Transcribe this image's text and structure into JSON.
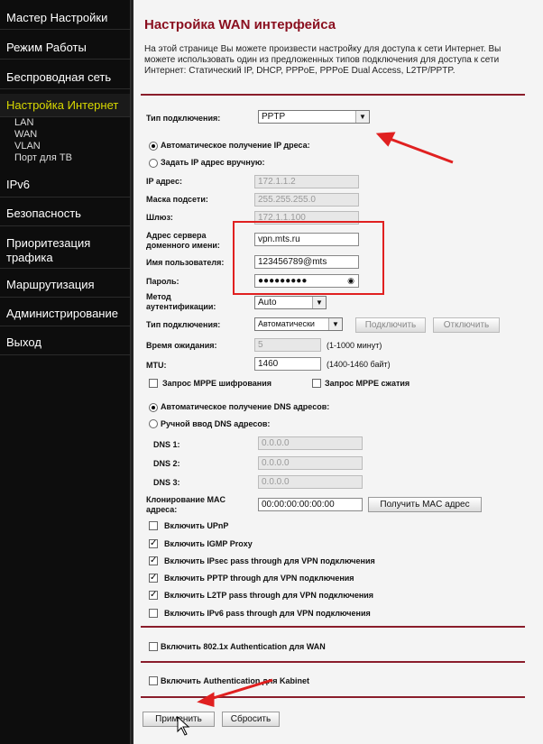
{
  "sidebar": {
    "items": [
      "Мастер Настройки",
      "Режим Работы",
      "Беспроводная сеть",
      "Настройка Интернет",
      "IPv6",
      "Безопасность",
      "Приоритезация трафика",
      "Маршрутизация",
      "Администрирование",
      "Выход"
    ],
    "sub": [
      "LAN",
      "WAN",
      "VLAN",
      "Порт для ТВ"
    ]
  },
  "page": {
    "title": "Настройка WAN интерфейса",
    "description": "На этой странице Вы можете произвести настройку для доступа к сети Интернет. Вы можете использовать один из предложенных типов подключения для доступа к сети Интернет: Статический IP, DHCP, PPPoE, PPPoE Dual Access, L2TP/PPTP."
  },
  "form": {
    "conn_type_label": "Тип подключения:",
    "conn_type_value": "PPTP",
    "auto_ip": "Автоматическое получение IP дреса:",
    "manual_ip": "Задать IP адрес вручную:",
    "ip_label": "IP адрес:",
    "ip_value": "172.1.1.2",
    "mask_label": "Маска подсети:",
    "mask_value": "255.255.255.0",
    "gw_label": "Шлюз:",
    "gw_value": "172.1.1.100",
    "server_label": "Адрес сервера доменного имени:",
    "server_value": "vpn.mts.ru",
    "user_label": "Имя пользователя:",
    "user_value": "123456789@mts",
    "pass_label": "Пароль:",
    "pass_value": "●●●●●●●●●",
    "auth_label": "Метод аутентификации:",
    "auth_value": "Auto",
    "conn_label": "Тип подключения:",
    "conn_value": "Автоматически",
    "connect_btn": "Подключить",
    "disconnect_btn": "Отключить",
    "idle_label": "Время ожидания:",
    "idle_value": "5",
    "idle_hint": "(1-1000 минут)",
    "mtu_label": "MTU:",
    "mtu_value": "1460",
    "mtu_hint": "(1400-1460 байт)",
    "mppe_enc": "Запрос MPPE шифрования",
    "mppe_comp": "Запрос MPPE сжатия",
    "auto_dns": "Автоматическое получение DNS адресов:",
    "manual_dns": "Ручной ввод DNS адресов:",
    "dns1_label": "DNS 1:",
    "dns2_label": "DNS 2:",
    "dns3_label": "DNS 3:",
    "dns_value": "0.0.0.0",
    "mac_label": "Клонирование MAC адреса:",
    "mac_value": "00:00:00:00:00:00",
    "mac_btn": "Получить MAC адрес",
    "upnp": "Включить UPnP",
    "igmp": "Включить IGMP Proxy",
    "ipsec": "Включить IPsec pass through для VPN подключения",
    "pptp": "Включить PPTP through для VPN подключения",
    "l2tp": "Включить L2TP pass through для VPN подключения",
    "ipv6pt": "Включить IPv6 pass through для VPN подключения",
    "dot1x": "Включить 802.1x Authentication для WAN",
    "kabinet": "Включить Authentication для Kabinet",
    "apply_btn": "Применить",
    "reset_btn": "Сбросить"
  }
}
